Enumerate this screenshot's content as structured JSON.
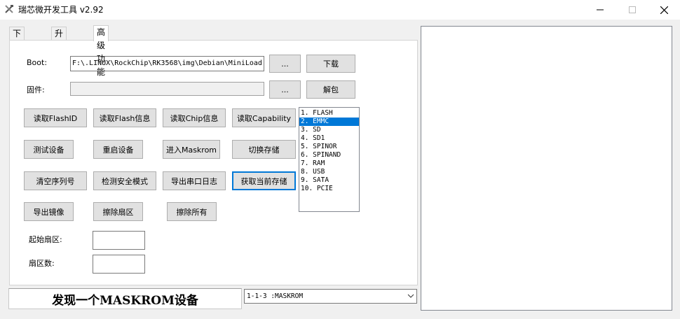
{
  "window": {
    "title": "瑞芯微开发工具 v2.92"
  },
  "tabs": [
    {
      "label": "下载镜像"
    },
    {
      "label": "升级固件"
    },
    {
      "label": "高级功能"
    }
  ],
  "boot": {
    "label": "Boot:",
    "value": "F:\\.LINUX\\RockChip\\RK3568\\img\\Debian\\MiniLoad",
    "browse_label": "...",
    "download_label": "下载"
  },
  "firmware": {
    "label": "固件:",
    "value": "",
    "browse_label": "...",
    "unpack_label": "解包"
  },
  "buttons": {
    "read_flash_id": "读取FlashID",
    "read_flash_info": "读取Flash信息",
    "read_chip_info": "读取Chip信息",
    "read_capability": "读取Capability",
    "test_device": "测试设备",
    "reset_device": "重启设备",
    "enter_maskrom": "进入Maskrom",
    "switch_storage": "切换存储",
    "clear_serial": "清空序列号",
    "check_secure_mode": "检测安全模式",
    "export_serial_log": "导出串口日志",
    "get_current_storage": "获取当前存储",
    "export_image": "导出镜像",
    "erase_sector": "擦除扇区",
    "erase_all": "擦除所有"
  },
  "storage_list": {
    "items": [
      "1.  FLASH",
      "2.  EMMC",
      "3.  SD",
      "4.  SD1",
      "5.  SPINOR",
      "6.  SPINAND",
      "7.  RAM",
      "8.  USB",
      "9.  SATA",
      "10.  PCIE"
    ],
    "selected_index": 1
  },
  "fields": {
    "start_sector_label": "起始扇区:",
    "start_sector_value": "",
    "sector_count_label": "扇区数:",
    "sector_count_value": ""
  },
  "status": {
    "text": "发现一个MASKROM设备"
  },
  "device_combo": {
    "value": "1-1-3 :MASKROM"
  },
  "colors": {
    "selection": "#0078d7",
    "focus_border": "#0078d7",
    "button_bg": "#e1e1e1",
    "window_bg": "#f0f0f0"
  }
}
